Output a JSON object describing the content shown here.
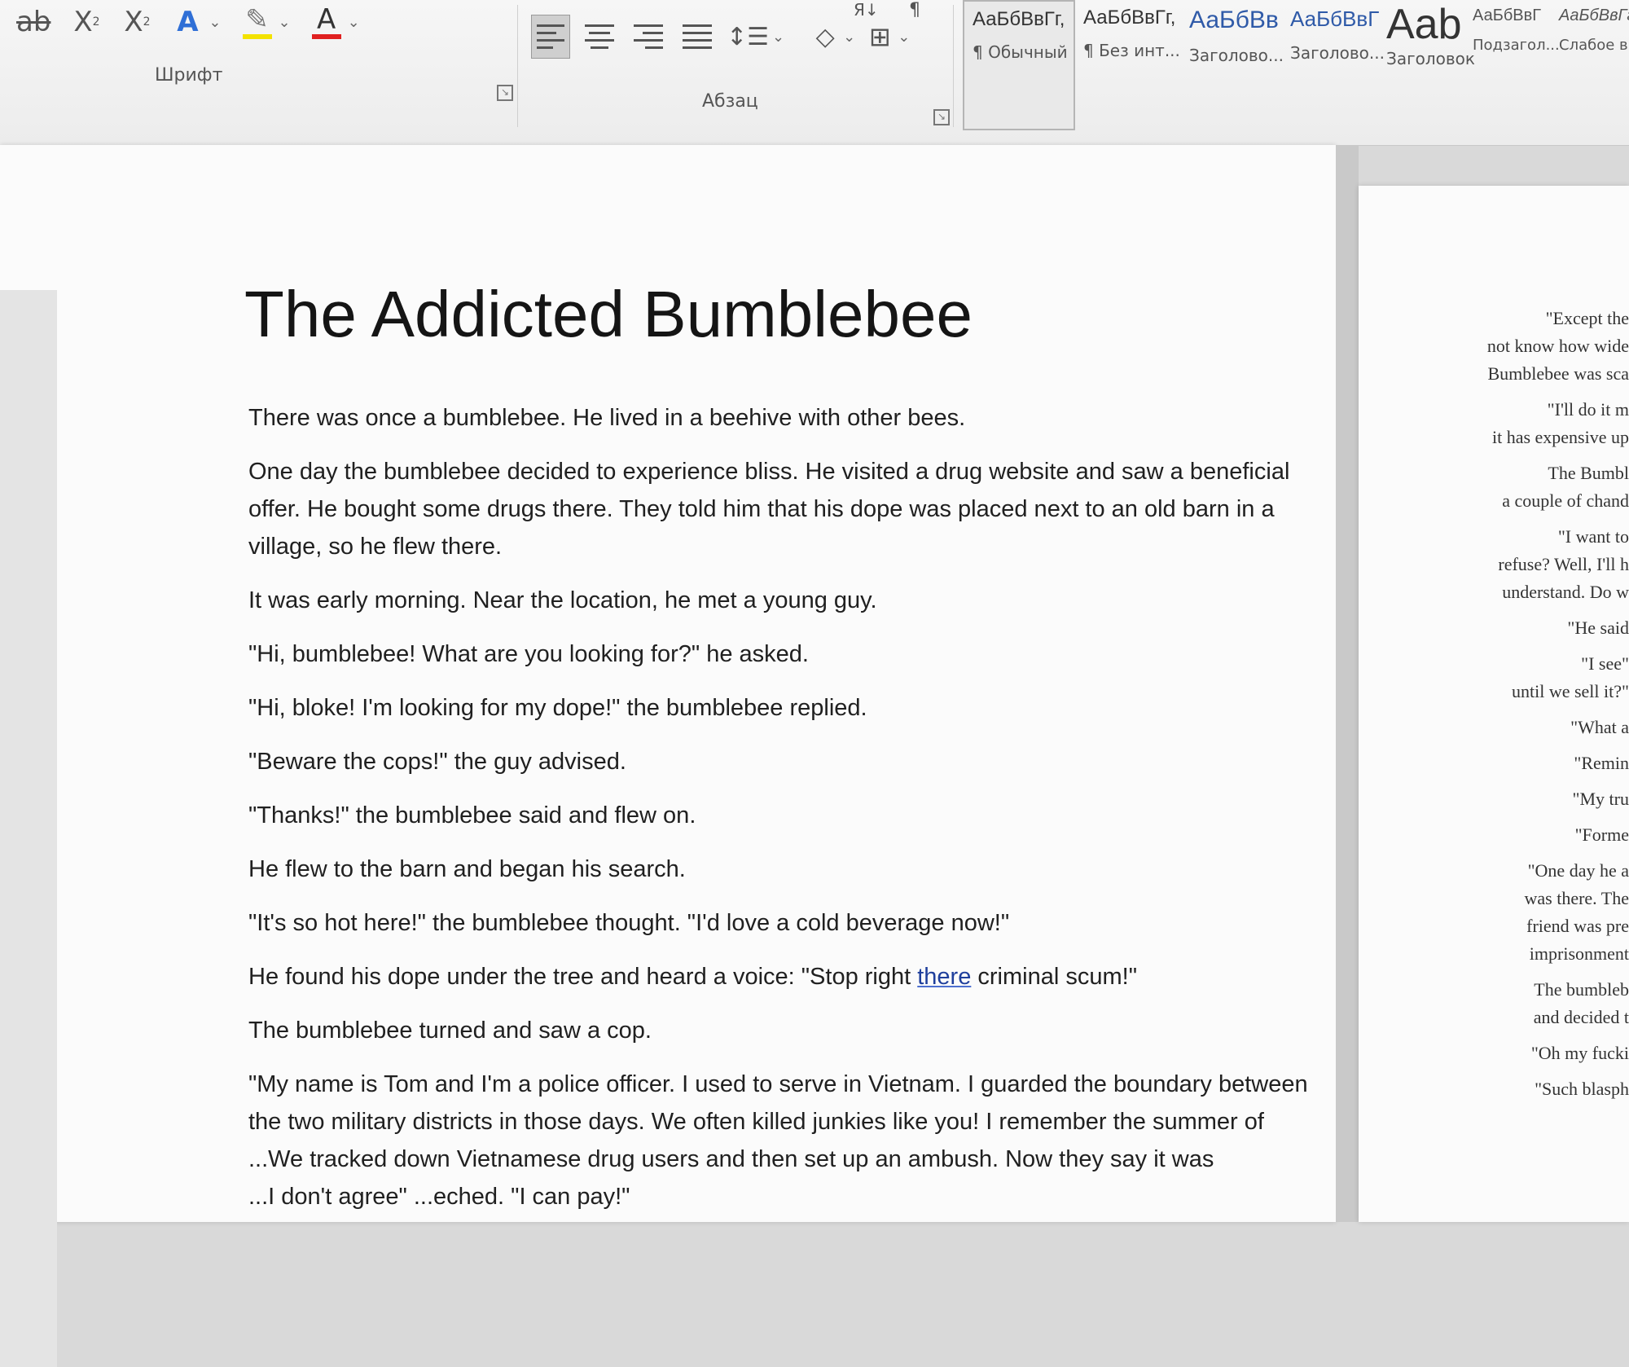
{
  "ribbon": {
    "font_group_label": "Шрифт",
    "paragraph_group_label": "Абзац",
    "font_buttons": {
      "strikethrough": "ab",
      "subscript": "X",
      "superscript": "X",
      "text_effects": "A",
      "highlight": "✎",
      "font_color": "A"
    },
    "sort_label": "Я↓",
    "pilcrow": "¶",
    "styles": [
      {
        "preview": "АаБбВвГг,",
        "name": "¶ Обычный"
      },
      {
        "preview": "АаБбВвГг,",
        "name": "¶ Без инт..."
      },
      {
        "preview": "АаБбВв",
        "name": "Заголово..."
      },
      {
        "preview": "АаБбВвГ",
        "name": "Заголово..."
      },
      {
        "preview": "Aab",
        "name": "Заголовок"
      },
      {
        "preview": "АаБбВвГ",
        "name": "Подзагол..."
      },
      {
        "preview": "АаБбВвГг",
        "name": "Слабое в..."
      }
    ]
  },
  "document": {
    "title": "The Addicted Bumblebee",
    "paragraphs": [
      [
        "There was once a bumblebee. He lived in a beehive with other bees."
      ],
      [
        "One day the bumblebee decided to experience bliss. He visited a drug website and saw a beneficial",
        "offer. He bought some drugs there. They told him that his dope was placed next to an old barn in a",
        "village, so he flew there."
      ],
      [
        "It was early morning. Near the location, he met a young guy."
      ],
      [
        "\"Hi, bumblebee! What are you looking for?\" he asked."
      ],
      [
        "\"Hi, bloke! I'm looking for my dope!\" the bumblebee replied."
      ],
      [
        "\"Beware the cops!\" the guy advised."
      ],
      [
        "\"Thanks!\" the bumblebee said and flew on."
      ],
      [
        "He flew to the barn and began his search."
      ],
      [
        "\"It's so hot here!\" the bumblebee thought. \"I'd love a cold beverage now!\""
      ],
      [
        "He found his dope under the tree and heard a voice: \"Stop right there criminal scum!\""
      ],
      [
        "The bumblebee turned and saw a cop."
      ],
      [
        "\"My name is Tom and I'm a police officer. I used to serve in Vietnam. I guarded the boundary between",
        "the two military districts in those days. We often killed junkies like you! I remember the summer of",
        "...We tracked down Vietnamese drug users and then set up an ambush. Now they say it was",
        "...I don't agree\"                              ...eched. \"I can pay!\""
      ]
    ],
    "page2_lines": [
      "\"Except the",
      "not know how wide",
      "Bumblebee was sca",
      "\"I'll do it m",
      "it has expensive up",
      "The Bumbl",
      "a couple of chand",
      "\"I want to",
      "refuse? Well, I'll h",
      "understand. Do w",
      "\"He said",
      "\"I see\"",
      "until we sell it?\"",
      "\"What a",
      "\"Remin",
      "\"My tru",
      "\"Forme",
      "\"One day he a",
      "was there. The",
      "friend was pre",
      "imprisonment",
      "The bumbleb",
      "and decided t",
      "\"Oh my fucki",
      "\"Such blasph"
    ]
  }
}
